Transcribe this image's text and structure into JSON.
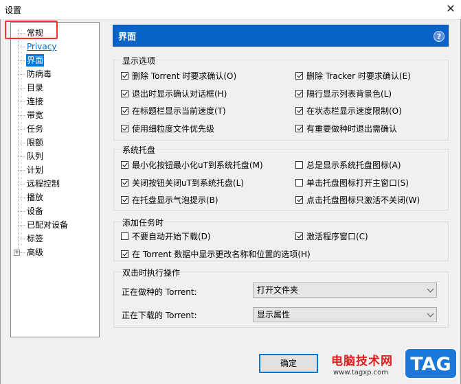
{
  "window": {
    "title": "设置",
    "close_glyph": "✕"
  },
  "sidebar": {
    "items": [
      {
        "label": "常规"
      },
      {
        "label": "Privacy"
      },
      {
        "label": "界面",
        "selected": true
      },
      {
        "label": "防病毒"
      },
      {
        "label": "目录"
      },
      {
        "label": "连接"
      },
      {
        "label": "带宽"
      },
      {
        "label": "任务"
      },
      {
        "label": "限额"
      },
      {
        "label": "队列"
      },
      {
        "label": "计划"
      },
      {
        "label": "远程控制"
      },
      {
        "label": "播放"
      },
      {
        "label": "设备"
      },
      {
        "label": "已配对设备"
      },
      {
        "label": "标签"
      },
      {
        "label": "高级",
        "expandable": true
      }
    ],
    "expander_glyph": "+"
  },
  "panel": {
    "title": "界面",
    "help_glyph": "?"
  },
  "groups": {
    "display": {
      "label": "显示选项",
      "options": [
        {
          "label": "删除 Torrent 时要求确认(O)",
          "checked": true
        },
        {
          "label": "删除 Tracker 时要求确认(E)",
          "checked": true
        },
        {
          "label": "退出时显示确认对话框(H)",
          "checked": true
        },
        {
          "label": "隔行显示列表背景色(L)",
          "checked": true
        },
        {
          "label": "在标题栏显示当前速度(T)",
          "checked": true
        },
        {
          "label": "在状态栏显示速度限制(O)",
          "checked": true
        },
        {
          "label": "使用细粒度文件优先级",
          "checked": true
        },
        {
          "label": "有重要做种时退出需确认",
          "checked": true
        }
      ]
    },
    "tray": {
      "label": "系统托盘",
      "options": [
        {
          "label": "最小化按钮最小化uT到系统托盘(M)",
          "checked": true
        },
        {
          "label": "总是显示系统托盘图标(A)",
          "checked": false
        },
        {
          "label": "关闭按钮关闭uT到系统托盘(L)",
          "checked": true
        },
        {
          "label": "单击托盘图标打开主窗口(S)",
          "checked": false
        },
        {
          "label": "在托盘显示气泡提示(B)",
          "checked": true
        },
        {
          "label": "点击托盘图标只激活不关闭(W)",
          "checked": true
        }
      ]
    },
    "add_task": {
      "label": "添加任务时",
      "options": [
        {
          "label": "不要自动开始下载(D)",
          "checked": false
        },
        {
          "label": "激活程序窗口(C)",
          "checked": true
        },
        {
          "label": "在 Torrent 数据中显示更改名称和位置的选项(H)",
          "checked": true
        }
      ]
    },
    "double_click": {
      "label": "双击时执行操作",
      "seeding_label": "正在做种的 Torrent:",
      "seeding_value": "打开文件夹",
      "downloading_label": "正在下载的 Torrent:",
      "downloading_value": "显示属性"
    }
  },
  "footer": {
    "ok_label": "确定"
  },
  "watermark": {
    "site_text": "电脑技术网",
    "url": "www.tagxp.com",
    "logo_text": "TAG"
  }
}
